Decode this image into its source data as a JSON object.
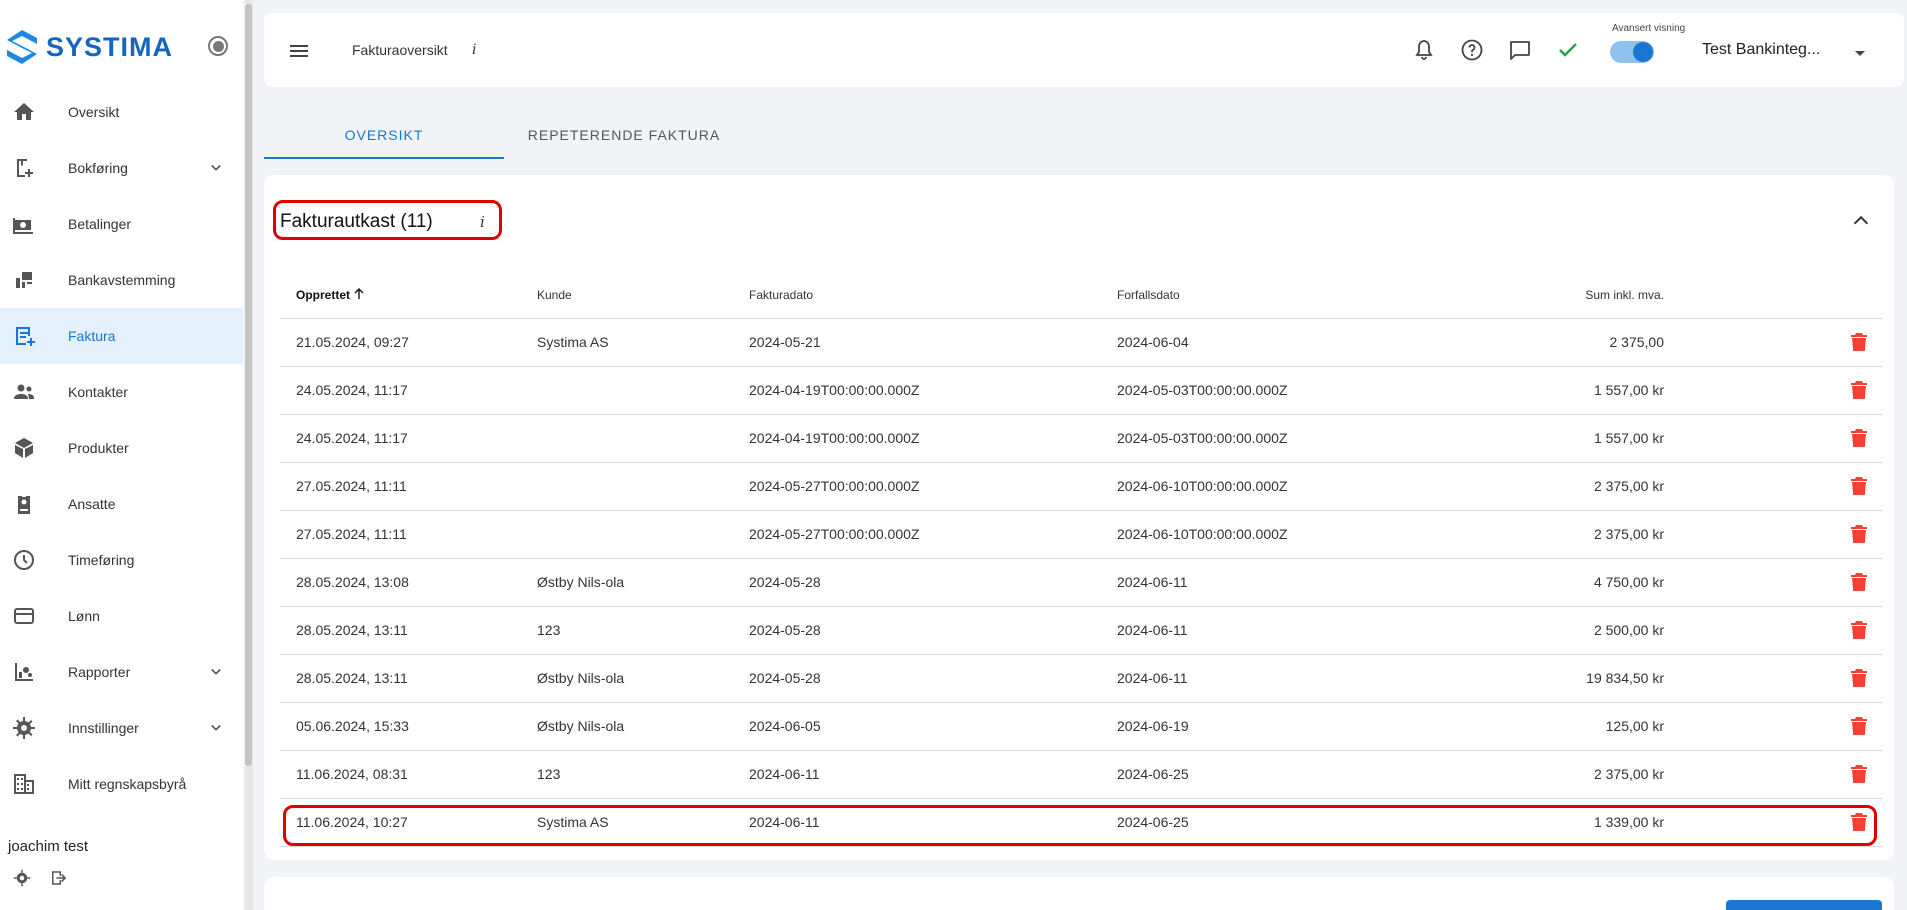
{
  "brand": {
    "logo_text": "SYSTIMA",
    "accent": "#1976d2"
  },
  "sidebar": {
    "items": [
      {
        "label": "Oversikt",
        "icon": "home-icon"
      },
      {
        "label": "Bokføring",
        "icon": "book-add-icon",
        "expandable": true
      },
      {
        "label": "Betalinger",
        "icon": "payments-icon"
      },
      {
        "label": "Bankavstemming",
        "icon": "bank-reconcile-icon"
      },
      {
        "label": "Faktura",
        "icon": "invoice-icon",
        "active": true
      },
      {
        "label": "Kontakter",
        "icon": "people-icon"
      },
      {
        "label": "Produkter",
        "icon": "box-icon"
      },
      {
        "label": "Ansatte",
        "icon": "badge-icon"
      },
      {
        "label": "Timeføring",
        "icon": "clock-icon"
      },
      {
        "label": "Lønn",
        "icon": "card-icon"
      },
      {
        "label": "Rapporter",
        "icon": "report-icon",
        "expandable": true
      },
      {
        "label": "Innstillinger",
        "icon": "gear-icon",
        "expandable": true
      },
      {
        "label": "Mitt regnskapsbyrå",
        "icon": "building-icon"
      }
    ],
    "user_name": "joachim test"
  },
  "header": {
    "title": "Fakturaoversikt",
    "info": "i",
    "toggle_label": "Avansert visning",
    "toggle_on": true,
    "company": "Test Bankinteg..."
  },
  "tabs": [
    {
      "label": "OVERSIKT",
      "active": true
    },
    {
      "label": "REPETERENDE FAKTURA",
      "active": false
    }
  ],
  "drafts": {
    "title": "Fakturautkast (11)",
    "info": "i",
    "columns": [
      "Opprettet",
      "Kunde",
      "Fakturadato",
      "Forfallsdato",
      "Sum inkl. mva."
    ],
    "rows": [
      [
        "21.05.2024, 09:27",
        "Systima AS",
        "2024-05-21",
        "2024-06-04",
        "2 375,00"
      ],
      [
        "24.05.2024, 11:17",
        "",
        "2024-04-19T00:00:00.000Z",
        "2024-05-03T00:00:00.000Z",
        "1 557,00 kr"
      ],
      [
        "24.05.2024, 11:17",
        "",
        "2024-04-19T00:00:00.000Z",
        "2024-05-03T00:00:00.000Z",
        "1 557,00 kr"
      ],
      [
        "27.05.2024, 11:11",
        "",
        "2024-05-27T00:00:00.000Z",
        "2024-06-10T00:00:00.000Z",
        "2 375,00 kr"
      ],
      [
        "27.05.2024, 11:11",
        "",
        "2024-05-27T00:00:00.000Z",
        "2024-06-10T00:00:00.000Z",
        "2 375,00 kr"
      ],
      [
        "28.05.2024, 13:08",
        "Østby Nils-ola",
        "2024-05-28",
        "2024-06-11",
        "4 750,00 kr"
      ],
      [
        "28.05.2024, 13:11",
        "123",
        "2024-05-28",
        "2024-06-11",
        "2 500,00 kr"
      ],
      [
        "28.05.2024, 13:11",
        "Østby Nils-ola",
        "2024-05-28",
        "2024-06-11",
        "19 834,50 kr"
      ],
      [
        "05.06.2024, 15:33",
        "Østby Nils-ola",
        "2024-06-05",
        "2024-06-19",
        "125,00 kr"
      ],
      [
        "11.06.2024, 08:31",
        "123",
        "2024-06-11",
        "2024-06-25",
        "2 375,00 kr"
      ],
      [
        "11.06.2024, 10:27",
        "Systima AS",
        "2024-06-11",
        "2024-06-25",
        "1 339,00 kr"
      ]
    ]
  },
  "colors": {
    "delete": "#f44336",
    "highlight": "#e00000",
    "active_bg": "#e4f0fb"
  }
}
